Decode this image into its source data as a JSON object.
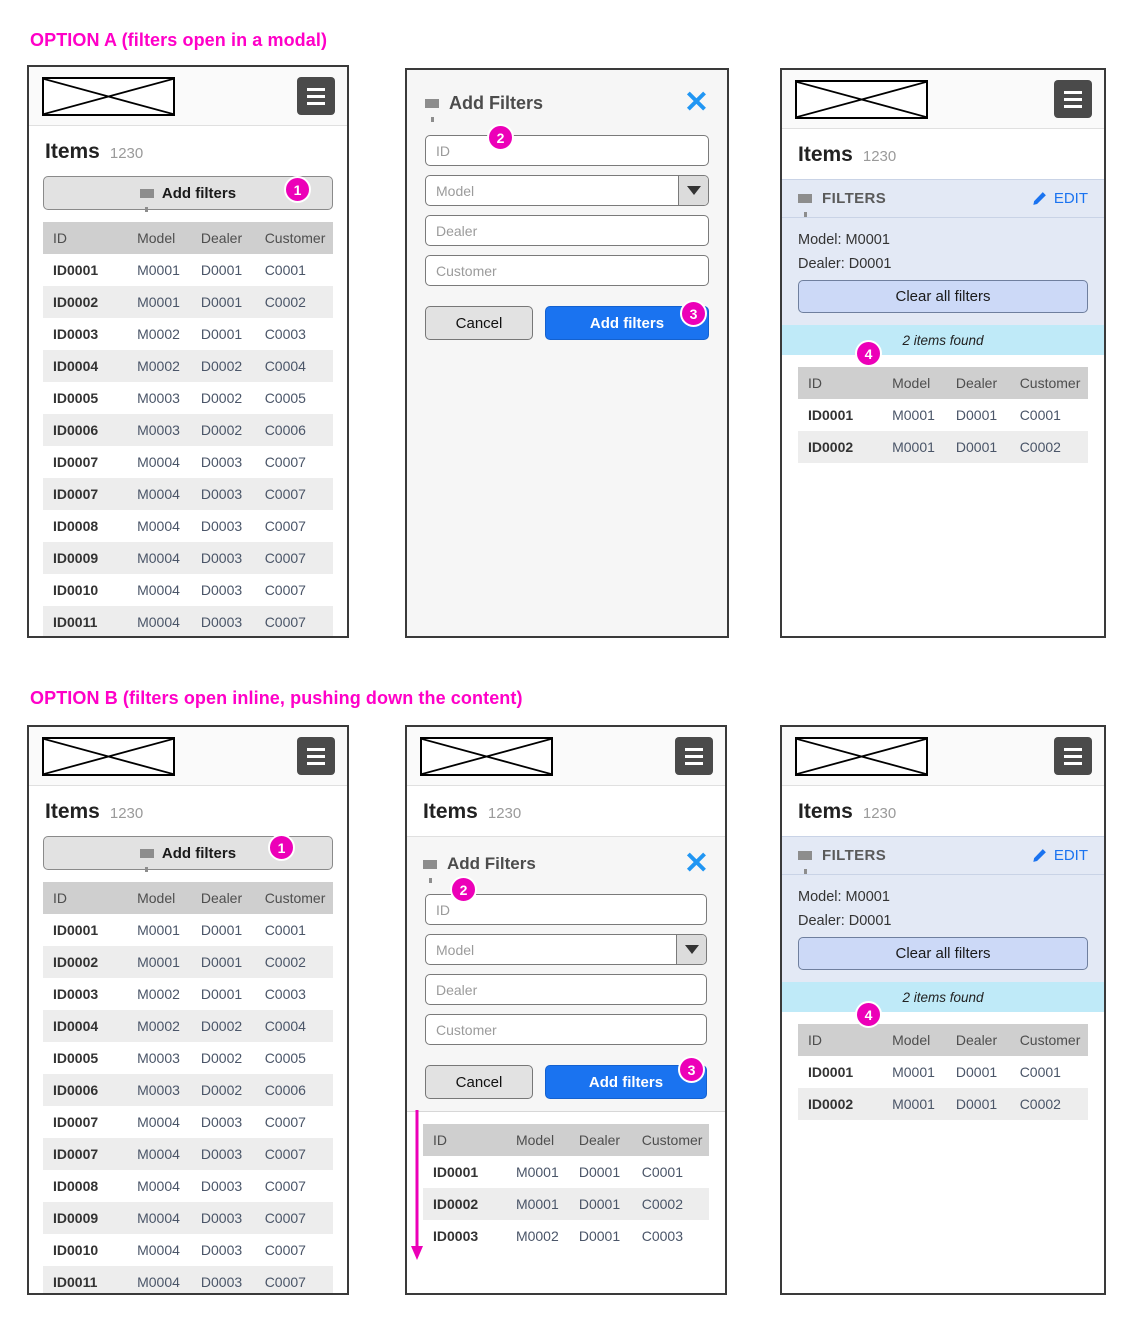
{
  "options": {
    "a_title": "OPTION A (filters open in a modal)",
    "b_title": "OPTION B (filters open inline, pushing down the content)"
  },
  "app": {
    "items_title": "Items",
    "items_count": "1230",
    "add_filters_button": "Add filters",
    "menu_icon": "hamburger-icon",
    "logo_icon": "placeholder-image-icon"
  },
  "modal": {
    "title": "Add Filters",
    "close_icon": "close-icon",
    "filter_icon": "funnel-icon",
    "fields": [
      {
        "placeholder": "ID",
        "type": "text"
      },
      {
        "placeholder": "Model",
        "type": "select"
      },
      {
        "placeholder": "Dealer",
        "type": "text"
      },
      {
        "placeholder": "Customer",
        "type": "text"
      }
    ],
    "cancel_label": "Cancel",
    "submit_label": "Add filters"
  },
  "filters_panel": {
    "label": "FILTERS",
    "edit_label": "EDIT",
    "edit_icon": "pencil-icon",
    "applied": [
      "Model: M0001",
      "Dealer: D0001"
    ],
    "clear_label": "Clear all filters",
    "found_text": "2 items found"
  },
  "table": {
    "columns": [
      "ID",
      "Model",
      "Dealer",
      "Customer"
    ],
    "full_rows": [
      [
        "ID0001",
        "M0001",
        "D0001",
        "C0001"
      ],
      [
        "ID0002",
        "M0001",
        "D0001",
        "C0002"
      ],
      [
        "ID0003",
        "M0002",
        "D0001",
        "C0003"
      ],
      [
        "ID0004",
        "M0002",
        "D0002",
        "C0004"
      ],
      [
        "ID0005",
        "M0003",
        "D0002",
        "C0005"
      ],
      [
        "ID0006",
        "M0003",
        "D0002",
        "C0006"
      ],
      [
        "ID0007",
        "M0004",
        "D0003",
        "C0007"
      ],
      [
        "ID0007",
        "M0004",
        "D0003",
        "C0007"
      ],
      [
        "ID0008",
        "M0004",
        "D0003",
        "C0007"
      ],
      [
        "ID0009",
        "M0004",
        "D0003",
        "C0007"
      ],
      [
        "ID0010",
        "M0004",
        "D0003",
        "C0007"
      ],
      [
        "ID0011",
        "M0004",
        "D0003",
        "C0007"
      ]
    ],
    "filtered_rows": [
      [
        "ID0001",
        "M0001",
        "D0001",
        "C0001"
      ],
      [
        "ID0002",
        "M0001",
        "D0001",
        "C0002"
      ]
    ],
    "pushed_rows": [
      [
        "ID0001",
        "M0001",
        "D0001",
        "C0001"
      ],
      [
        "ID0002",
        "M0001",
        "D0001",
        "C0002"
      ],
      [
        "ID0003",
        "M0002",
        "D0001",
        "C0003"
      ]
    ]
  },
  "badges": {
    "one": "1",
    "two": "2",
    "three": "3",
    "four": "4"
  },
  "colors": {
    "accent_pink": "#ec00b8",
    "primary_blue": "#1a73f0",
    "filters_bg": "#e3e9f5",
    "found_bg": "#bfeaf8",
    "burger_bg": "#4a4a4a"
  }
}
